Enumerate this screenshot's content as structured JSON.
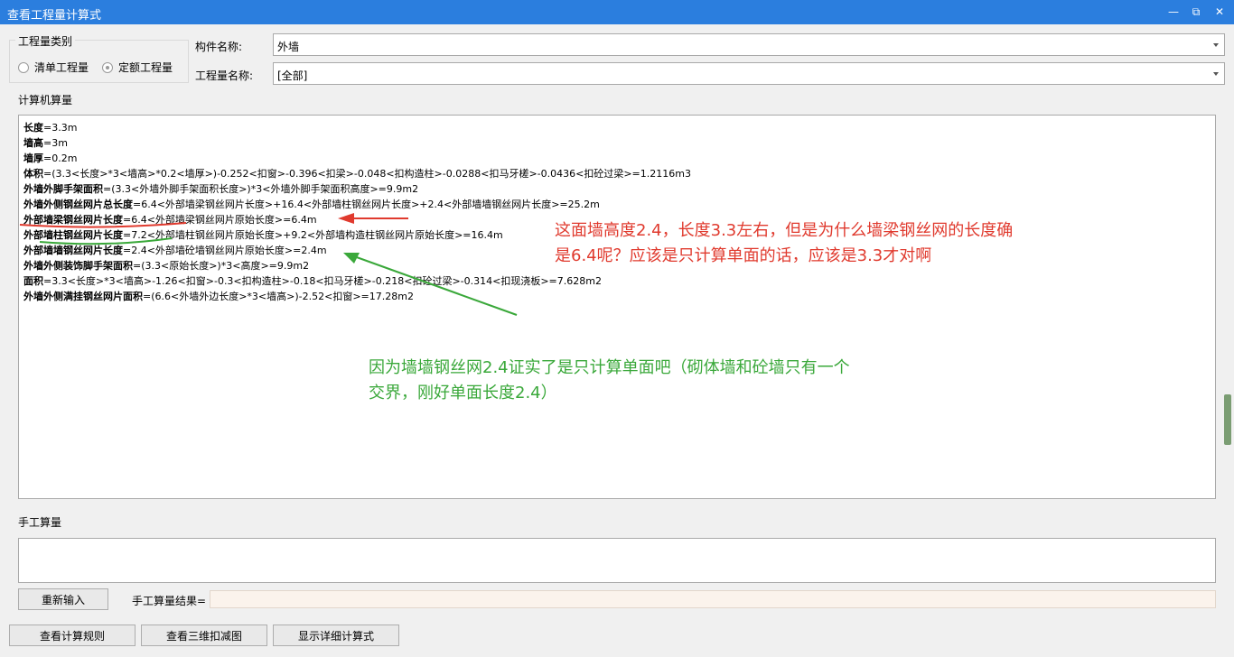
{
  "window": {
    "title": "查看工程量计算式",
    "minimize": "—",
    "restore": "⧉",
    "close": "✕"
  },
  "quantity_type": {
    "title": "工程量类别",
    "options": [
      "清单工程量",
      "定额工程量"
    ],
    "selected": "定额工程量"
  },
  "component": {
    "label": "构件名称:",
    "value": "外墙"
  },
  "quantity_name": {
    "label": "工程量名称:",
    "value": "[全部]"
  },
  "computer_calc": {
    "title": "计算机算量",
    "lines": [
      {
        "name": "长度",
        "formula": "=3.3m"
      },
      {
        "name": "墙高",
        "formula": "=3m"
      },
      {
        "name": "墙厚",
        "formula": "=0.2m"
      },
      {
        "name": "体积",
        "formula": "=(3.3<长度>*3<墙高>*0.2<墙厚>)-0.252<扣窗>-0.396<扣梁>-0.048<扣构造柱>-0.0288<扣马牙槎>-0.0436<扣砼过梁>=1.2116m3"
      },
      {
        "name": "外墙外脚手架面积",
        "formula": "=(3.3<外墙外脚手架面积长度>)*3<外墙外脚手架面积高度>=9.9m2"
      },
      {
        "name": "外墙外侧钢丝网片总长度",
        "formula": "=6.4<外部墙梁钢丝网片长度>+16.4<外部墙柱钢丝网片长度>+2.4<外部墙墙钢丝网片长度>=25.2m"
      },
      {
        "name": "外部墙梁钢丝网片长度",
        "formula": "=6.4<外部墙梁钢丝网片原始长度>=6.4m"
      },
      {
        "name": "外部墙柱钢丝网片长度",
        "formula": "=7.2<外部墙柱钢丝网片原始长度>+9.2<外部墙构造柱钢丝网片原始长度>=16.4m"
      },
      {
        "name": "外部墙墙钢丝网片长度",
        "formula": "=2.4<外部墙砼墙钢丝网片原始长度>=2.4m"
      },
      {
        "name": "外墙外侧装饰脚手架面积",
        "formula": "=(3.3<原始长度>)*3<高度>=9.9m2"
      },
      {
        "name": "面积",
        "formula": "=3.3<长度>*3<墙高>-1.26<扣窗>-0.3<扣构造柱>-0.18<扣马牙槎>-0.218<扣砼过梁>-0.314<扣现浇板>=7.628m2"
      },
      {
        "name": "外墙外侧满挂钢丝网片面积",
        "formula": "=(6.6<外墙外边长度>*3<墙高>)-2.52<扣窗>=17.28m2"
      }
    ]
  },
  "annotations": {
    "red_line1": "这面墙高度2.4，长度3.3左右，但是为什么墙梁钢丝网的长度确",
    "red_line2": "是6.4呢？应该是只计算单面的话，应该是3.3才对啊",
    "green_line1": "因为墙墙钢丝网2.4证实了是只计算单面吧（砌体墙和砼墙只有一个",
    "green_line2": "交界，刚好单面长度2.4）",
    "red_color": "#e03a2e",
    "green_color": "#3aa83a"
  },
  "manual_calc": {
    "title": "手工算量",
    "reinput_button": "重新输入",
    "result_label": "手工算量结果="
  },
  "bottom_buttons": {
    "view_rules": "查看计算规则",
    "view_3d": "查看三维扣减图",
    "show_detail": "显示详细计算式"
  }
}
